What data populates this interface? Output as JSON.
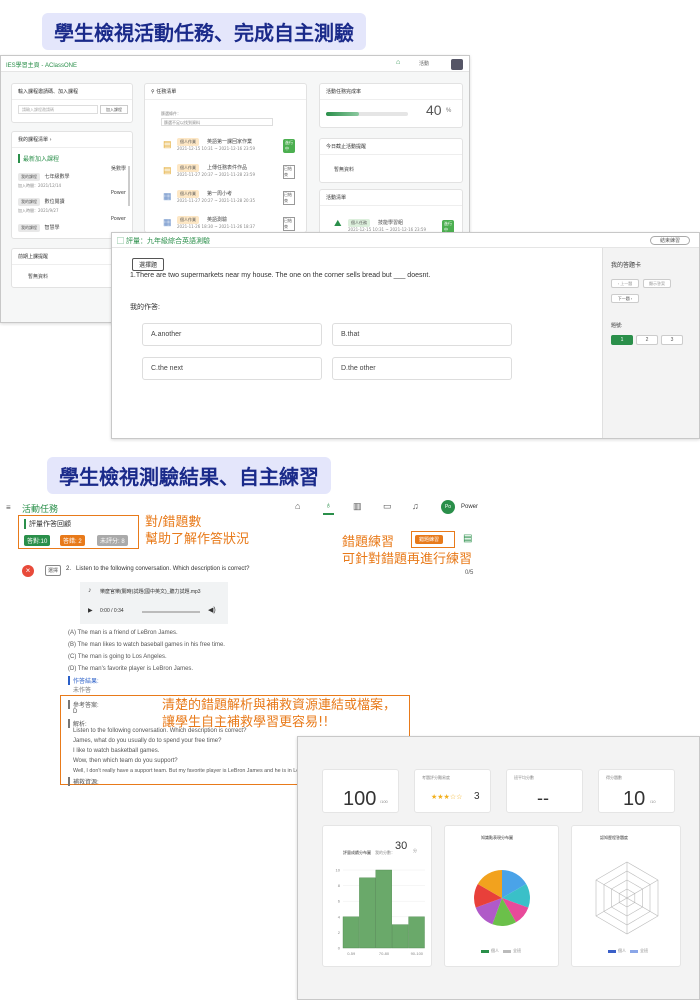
{
  "banners": {
    "top": "學生檢視活動任務、完成自主測驗",
    "bottom": "學生檢視測驗結果、自主練習"
  },
  "dashboard": {
    "app_title": "IES學習主頁 - AClassONE",
    "header_right": "活動",
    "course_entry": {
      "title": "輸入課程邀請碼、加入課程",
      "placeholder": "請輸入課程邀請碼",
      "join_button": "加入課程"
    },
    "my_courses": {
      "title": "我的課程清單 ›",
      "subtitle": "最新加入課程",
      "items": [
        {
          "tag": "我的課程",
          "name": "七年級數學",
          "teacher": "吳數學",
          "date": "加入時間：2021/12/14"
        },
        {
          "tag": "我的課程",
          "name": "數位閱讀",
          "teacher": "Power",
          "date": "加入時間：2021/9/27"
        },
        {
          "tag": "我的課程",
          "name": "智慧學",
          "teacher": "Power",
          "date": ""
        }
      ]
    },
    "last_course": {
      "title": "前期上課提醒",
      "empty": "暫無資料"
    },
    "task_list": {
      "title": "任務清單",
      "filter_label": "篩選條件：",
      "filter_placeholder": "篩選不足以找到資料",
      "items": [
        {
          "tag": "個人作業",
          "name": "英語第一課回家作業",
          "date": "2021-12-15 10:31 ~ 2021-12-16 23:59",
          "btn": "進行中"
        },
        {
          "tag": "個人作業",
          "name": "上傳任務表件作品",
          "date": "2021-11-27 20:37 ~ 2021-11-28 23:59",
          "btn": "已結束"
        },
        {
          "tag": "個人作業",
          "name": "第一周小考",
          "date": "2021-11-27 20:27 ~ 2021-11-28 20:35",
          "btn": "已結束"
        },
        {
          "tag": "個人作業",
          "name": "英語測驗",
          "date": "2021-11-26 18:30 ~ 2021-11-26 18:37",
          "btn": "已結束"
        }
      ]
    },
    "completion": {
      "title": "活動任務完成率",
      "value": "40",
      "unit": "%",
      "progress": 0.4
    },
    "today_events": {
      "title": "今日截止活動提醒",
      "empty": "暫無資料"
    },
    "activity_list": {
      "title": "活動清單",
      "item": {
        "tag": "個人任務",
        "name": "技能學習組",
        "date": "2021-12-15 10:31 ~ 2021-12-16 23:59",
        "btn": "進行中"
      }
    }
  },
  "quiz": {
    "title": "評量：九年級綜合英語測驗",
    "finish_button": "結束練習",
    "type_badge": "選擇題",
    "question": "1.There are two supermarkets near my house. The one on the corner sells bread but ___ doesnt.",
    "my_answer_label": "我的作答:",
    "options": [
      "A.another",
      "B.that",
      "C.the next",
      "D.the other"
    ],
    "answer_card": {
      "title": "我的答題卡",
      "prev": "‹ 上一題",
      "mark": "顯示答案",
      "next": "下一題 ›",
      "q_label": "題號:",
      "numbers": [
        "1",
        "2",
        "3"
      ]
    }
  },
  "result": {
    "menu_title": "活動任務",
    "user_badge": "Po",
    "user_name": "Power",
    "review_title": "評量作答回顧",
    "chips": {
      "correct": "答對:10",
      "wrong": "答錯: 2",
      "unscored": "未評分: 8"
    },
    "annot1": [
      "對/錯題數",
      "幫助了解作答狀況"
    ],
    "annot2": [
      "錯題練習",
      "可針對錯題再進行練習"
    ],
    "wrong_practice_button": "錯題練習",
    "progress_count": "0/5",
    "q_type": "選擇",
    "q_number": "2.",
    "q_text": "Listen to the following conversation. Which description is correct?",
    "audio_name": "樂麼官樂(關時)試題(國中英文)_聽力試題.mp3",
    "audio_time": "0:00 / 0:34",
    "choices": [
      "(A)  The man is a friend of LeBron James.",
      "(B)  The man likes to watch baseball games in his free time.",
      "(C)  The man is going to Los Angeles.",
      "(D)  The man's favorite player is LeBron James."
    ],
    "answer_result_label": "作答結果:",
    "answer_result": "未作答",
    "ref_label": "參考答案:",
    "ref_value": "D",
    "analysis_label": "解析:",
    "analysis_lines": [
      "Listen to the following conversation. Which description is correct?",
      "James, what do you usually do to spend your free time?",
      "I like to watch basketball games.",
      "Wow, then which team do you support?",
      "Well, I don't really have a support team. But my favorite player is LeBron James and he is in Los Angeles Lakers now."
    ],
    "resource_label": "補救資源:",
    "annot3": [
      "清楚的錯題解析與補救資源連結或檔案，",
      "讓學生自主補救學習更容易!!"
    ]
  },
  "stats": {
    "cards": [
      {
        "label": "",
        "value": "100",
        "sub": "/100"
      },
      {
        "label": "考題評分難易度",
        "value": "3",
        "sub": ""
      },
      {
        "label": "班平均分數",
        "value": "--",
        "sub": ""
      },
      {
        "label": "得分題數",
        "value": "10",
        "sub": "/10"
      }
    ],
    "hist_title": "評量成績分布圖",
    "hist_side": "我的分數：",
    "hist_value": "30",
    "hist_unit": "分",
    "pie_title": "知識點表現分布圖",
    "radar_title": "認知歷程答題度",
    "legend": [
      "個人",
      "全班"
    ]
  },
  "chart_data": [
    {
      "type": "bar",
      "title": "評量成績分布圖",
      "categories": [
        "0-59",
        "",
        "70-80",
        "",
        "90-100"
      ],
      "values": [
        4,
        9,
        10,
        3,
        4
      ],
      "ylim": [
        0,
        10
      ]
    }
  ],
  "colors": {
    "green": "#4caf50",
    "orange": "#e87a1a",
    "banner_bg": "#e4e6fb",
    "banner_text": "#1a2a8a",
    "bar": "#6aa96a"
  }
}
